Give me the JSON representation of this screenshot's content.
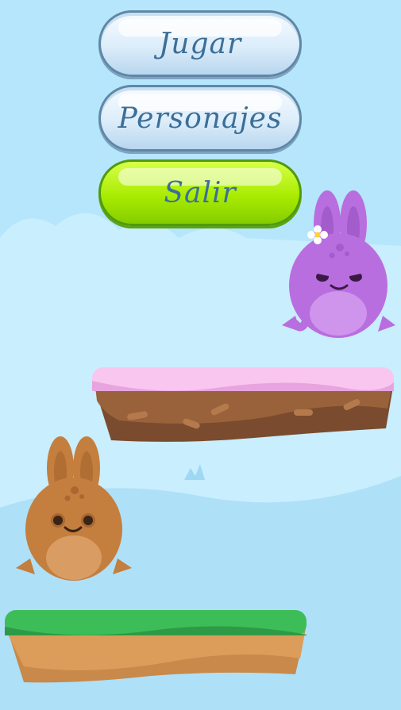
{
  "menu": {
    "play_label": "Jugar",
    "characters_label": "Personajes",
    "exit_label": "Salir"
  },
  "colors": {
    "sky": "#b6e6fb",
    "button_blue": "#dcedfa",
    "button_green": "#a9ec00",
    "button_text": "#3b6f99",
    "purple_bunny": "#b96ee0",
    "brown_bunny": "#c47e3e",
    "frosting": "#f9c6f0",
    "grass": "#3dbd57"
  },
  "characters": [
    {
      "name": "purple-bunny",
      "color": "#b96ee0",
      "accessory": "flower"
    },
    {
      "name": "brown-bunny",
      "color": "#c47e3e"
    }
  ]
}
